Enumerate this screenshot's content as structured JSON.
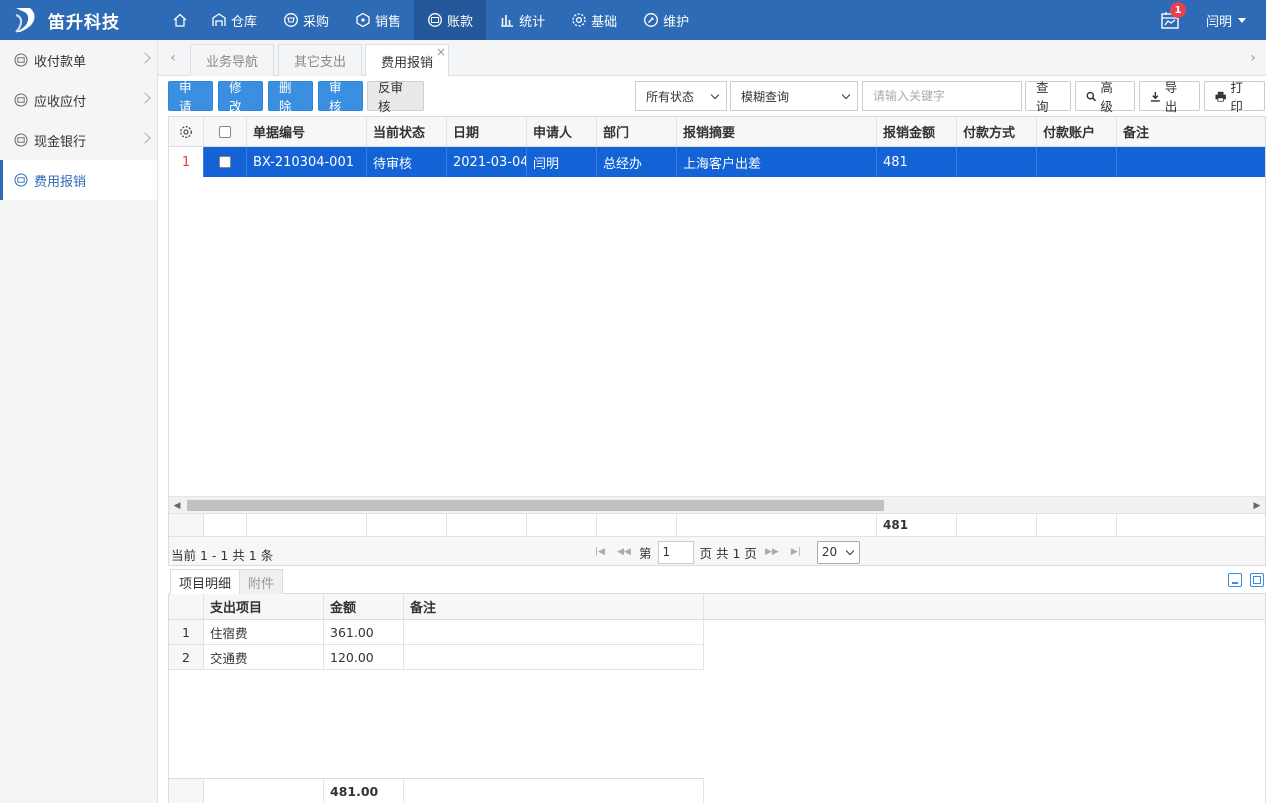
{
  "brand": {
    "name": "笛升科技"
  },
  "nav": {
    "items": [
      {
        "label": "仓库",
        "icon": "warehouse-icon"
      },
      {
        "label": "采购",
        "icon": "cart-icon"
      },
      {
        "label": "销售",
        "icon": "tag-icon"
      },
      {
        "label": "账款",
        "icon": "money-icon",
        "active": true
      },
      {
        "label": "统计",
        "icon": "bar-chart-icon"
      },
      {
        "label": "基础",
        "icon": "gear-icon"
      },
      {
        "label": "维护",
        "icon": "maintenance-icon"
      }
    ]
  },
  "header": {
    "notification_count": "1",
    "user_name": "闫明"
  },
  "sidebar": {
    "items": [
      {
        "label": "收付款单"
      },
      {
        "label": "应收应付"
      },
      {
        "label": "现金银行"
      },
      {
        "label": "费用报销",
        "active": true
      }
    ]
  },
  "tabs": [
    {
      "label": "业务导航"
    },
    {
      "label": "其它支出"
    },
    {
      "label": "费用报销",
      "active": true
    }
  ],
  "toolbar": {
    "apply": "申请",
    "edit": "修改",
    "delete": "删除",
    "approve": "审核",
    "unapprove": "反审核",
    "status_select": "所有状态",
    "query_mode_select": "模糊查询",
    "keyword_placeholder": "请输入关键字",
    "query": "查询",
    "advanced": "高级",
    "export": "导出",
    "print": "打印"
  },
  "grid": {
    "columns": [
      "单据编号",
      "当前状态",
      "日期",
      "申请人",
      "部门",
      "报销摘要",
      "报销金额",
      "付款方式",
      "付款账户",
      "备注"
    ],
    "rows": [
      {
        "num": "1",
        "code": "BX-210304-001",
        "status": "待审核",
        "date": "2021-03-04",
        "applicant": "闫明",
        "dept": "总经办",
        "summary": "上海客户出差",
        "amount": "481",
        "pay_method": "",
        "pay_account": "",
        "remark": ""
      }
    ],
    "total_amount": "481"
  },
  "pager": {
    "info": "当前 1 - 1 共 1 条",
    "page_prefix": "第",
    "page_value": "1",
    "page_suffix": "页 共 1 页",
    "page_size": "20"
  },
  "detail": {
    "tabs": [
      {
        "label": "项目明细",
        "active": true
      },
      {
        "label": "附件"
      }
    ],
    "columns": [
      "支出项目",
      "金额",
      "备注"
    ],
    "rows": [
      {
        "num": "1",
        "item": "住宿费",
        "amount": "361.00",
        "remark": ""
      },
      {
        "num": "2",
        "item": "交通费",
        "amount": "120.00",
        "remark": ""
      }
    ],
    "total_amount": "481.00"
  },
  "colors": {
    "primary": "#2e6bb6",
    "button_blue": "#3b8fe0",
    "row_selected": "#1463d6",
    "badge": "#e8414c"
  }
}
